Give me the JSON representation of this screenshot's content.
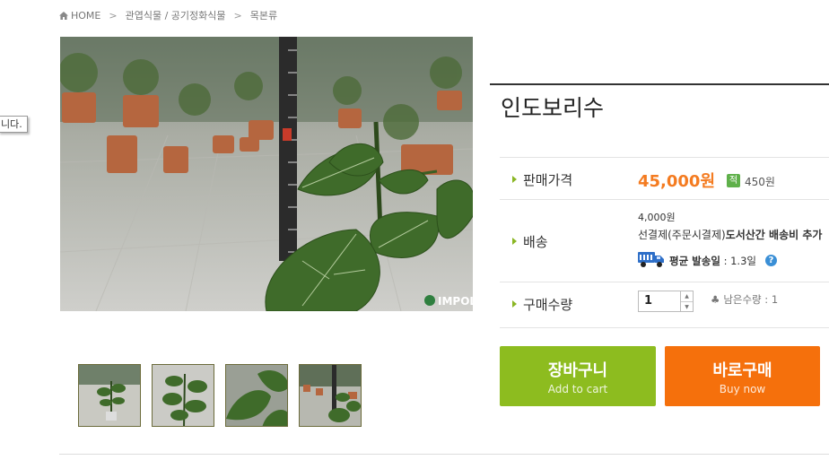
{
  "breadcrumb": {
    "home": "HOME",
    "sep1": ">",
    "category": "관엽식물 / 공기정화식물",
    "sep2": ">",
    "subcategory": "목본류"
  },
  "tooltip_fragment": "니다.",
  "photo": {
    "watermark": "IMPOL"
  },
  "product": {
    "title": "인도보리수"
  },
  "price": {
    "label": "판매가격",
    "value": "45,000원",
    "point_badge": "적",
    "point_value": "450원"
  },
  "shipping": {
    "label": "배송",
    "cost": "4,000원",
    "method_prefix": "선결제(주문시결제)",
    "method_bold": "도서산간 배송비 추가",
    "avg_label": "평균 발송일",
    "avg_value": ": 1.3일",
    "help": "?"
  },
  "quantity": {
    "label": "구매수량",
    "value": "1",
    "remaining": "남은수량 : 1"
  },
  "buttons": {
    "cart_ko": "장바구니",
    "cart_en": "Add to cart",
    "buy_ko": "바로구매",
    "buy_en": "Buy now"
  },
  "colors": {
    "accent_green": "#8dbc1f",
    "accent_orange": "#f5700c",
    "price_orange": "#f47b20"
  }
}
